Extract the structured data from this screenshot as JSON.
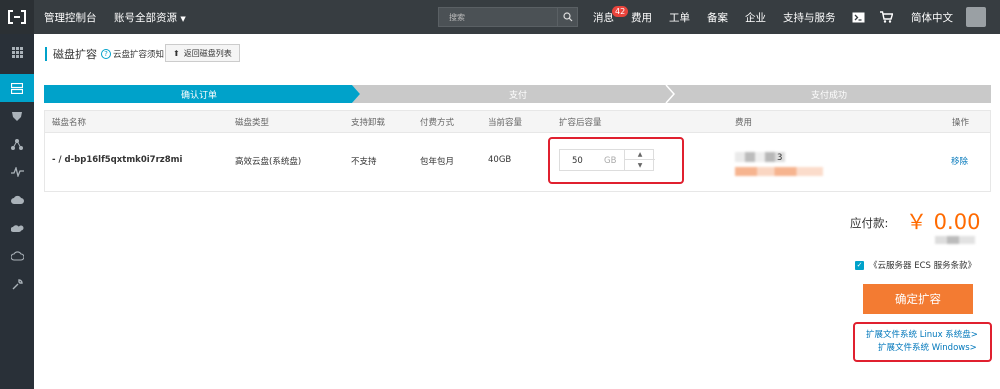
{
  "topbar": {
    "console": "管理控制台",
    "account_resources": "账号全部资源",
    "search_placeholder": "搜索",
    "messages": "消息",
    "message_count": "42",
    "billing": "费用",
    "tickets": "工单",
    "filing": "备案",
    "enterprise": "企业",
    "support": "支持与服务",
    "language": "简体中文"
  },
  "page": {
    "title": "磁盘扩容",
    "help_text": "云盘扩容须知",
    "back_button": "返回磁盘列表"
  },
  "steps": [
    "确认订单",
    "支付",
    "支付成功"
  ],
  "colors": {
    "accent": "#00a2ca",
    "step_active": "#00a2ca",
    "step_inactive": "#c9c9c9",
    "price": "#ff6a00",
    "button": "#f37b32",
    "highlight": "#e0202f"
  },
  "table": {
    "headers": [
      "磁盘名称",
      "磁盘类型",
      "支持卸载",
      "付费方式",
      "当前容量",
      "扩容后容量",
      "费用",
      "操作"
    ],
    "row": {
      "name": "- / d-bp16lf5qxtmk0i7rz8mi",
      "type": "高效云盘(系统盘)",
      "detachable": "不支持",
      "billing": "包年包月",
      "current_capacity": "40GB",
      "new_capacity_value": "50",
      "new_capacity_unit": "GB",
      "fee_partial": "3",
      "action": "移除"
    }
  },
  "summary": {
    "payable_label": "应付款:",
    "amount": "￥ 0.00",
    "agreement": "《云服务器 ECS 服务条款》",
    "confirm_button": "确定扩容"
  },
  "links": {
    "linux": "扩展文件系统 Linux 系统盘>",
    "windows": "扩展文件系统 Windows>"
  }
}
